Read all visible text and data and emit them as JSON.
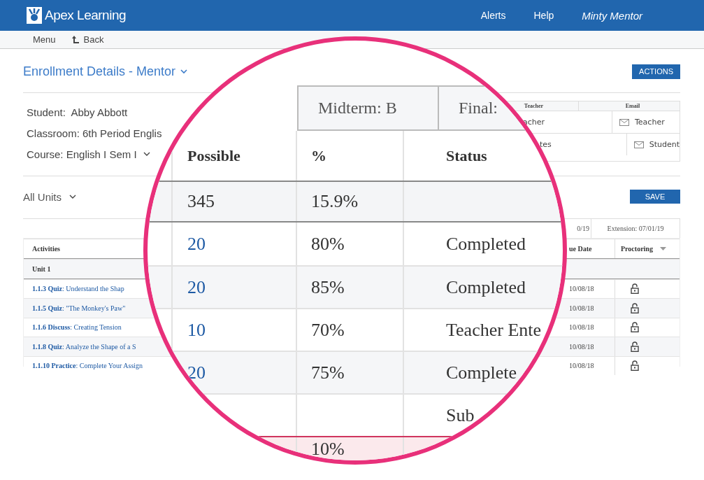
{
  "header": {
    "brand": "Apex Learning",
    "nav": [
      "Alerts",
      "Help"
    ],
    "user": "Minty Mentor"
  },
  "subnav": {
    "menu": "Menu",
    "back": "Back"
  },
  "page": {
    "title": "Enrollment Details - Mentor",
    "actions": "ACTIONS"
  },
  "info": {
    "student_label": "Student:",
    "student": "Abby Abbott",
    "classroom": "Classroom: 6th Period Englis",
    "course": "Course: English I Sem I"
  },
  "contacts": {
    "columns": [
      "Teacher",
      "Email"
    ],
    "rows": [
      {
        "name": "acher",
        "email": "Teacher"
      },
      {
        "name": "tes",
        "email": "Student"
      }
    ]
  },
  "units_filter": "All Units",
  "save": "SAVE",
  "activities": {
    "dates": [
      "0/19",
      "Extension: 07/01/19"
    ],
    "columns": [
      "Activities",
      "ue Date",
      "Proctoring"
    ],
    "unit": "Unit 1",
    "rows": [
      {
        "title": "**1.1.3 Quiz**: Understand the Shap",
        "due": "10/08/18",
        "locked": false
      },
      {
        "title": "**1.1.5 Quiz**: \"The Monkey's Paw\"",
        "due": "10/08/18",
        "locked": false
      },
      {
        "title": "**1.1.6 Discuss**: Creating Tension",
        "due": "10/08/18",
        "locked": false
      },
      {
        "title": "**1.1.8 Quiz**: Analyze the Shape of a S",
        "due": "10/08/18",
        "locked": false
      },
      {
        "title": "**1.1.10 Practice**: Complete Your Assign",
        "due": "10/08/18",
        "locked": false
      }
    ]
  },
  "lens": {
    "grades": [
      "Midterm: B",
      "Final:"
    ],
    "columns": [
      "Possible",
      "%",
      "Status"
    ],
    "total": {
      "possible": "345",
      "percent": "15.9%"
    },
    "rows": [
      {
        "possible": "20",
        "percent": "80%",
        "status": "Completed",
        "highlighted": false
      },
      {
        "possible": "20",
        "percent": "85%",
        "status": "Completed",
        "highlighted": false
      },
      {
        "possible": "10",
        "percent": "70%",
        "status": "Teacher Ente",
        "highlighted": false
      },
      {
        "possible": "20",
        "percent": "75%",
        "status": "Complete",
        "highlighted": false
      },
      {
        "status": "Sub",
        "highlighted": false
      },
      {
        "percent": "10%",
        "highlighted": true
      }
    ]
  }
}
